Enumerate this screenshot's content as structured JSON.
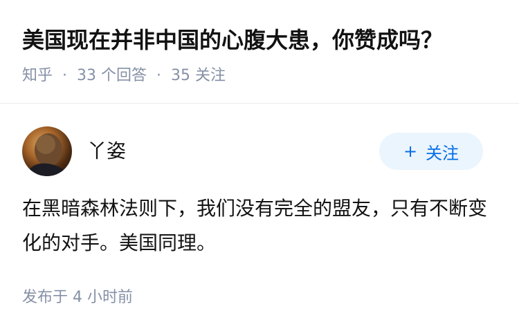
{
  "question": {
    "title": "美国现在并非中国的心腹大患，你赞成吗？",
    "source": "知乎",
    "separator": "·",
    "answers_count": "33 个回答",
    "followers_count": "35 关注"
  },
  "answer": {
    "author": {
      "name": "丫姿",
      "avatar_icon": "person-avatar"
    },
    "follow_button": {
      "icon": "+",
      "label": "关注"
    },
    "content": "在黑暗森林法则下，我们没有完全的盟友，只有不断变化的对手。美国同理。",
    "publish_time": "发布于 4 小时前"
  },
  "colors": {
    "title": "#121212",
    "meta": "#8590a6",
    "accent": "#056de8",
    "follow_bg": "#ebf5fd",
    "divider": "#ebebeb"
  }
}
